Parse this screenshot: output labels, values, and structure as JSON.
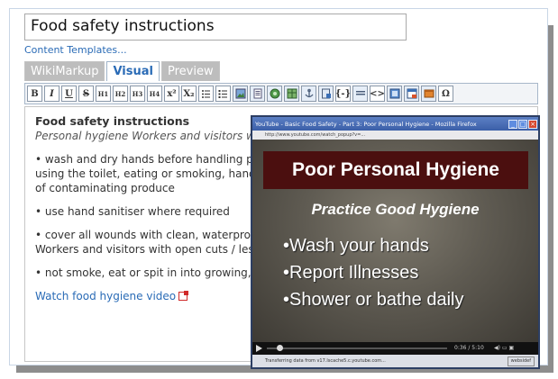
{
  "page": {
    "title_value": "Food safety instructions",
    "templates_link": "Content Templates..."
  },
  "tabs": [
    {
      "label": "WikiMarkup",
      "active": false
    },
    {
      "label": "Visual",
      "active": true
    },
    {
      "label": "Preview",
      "active": false
    }
  ],
  "toolbar": {
    "bold": "B",
    "italic": "I",
    "underline": "U",
    "strike": "S",
    "h1": "H1",
    "h2": "H2",
    "h3": "H3",
    "h4": "H4",
    "superscript": "x²",
    "subscript": "X₂",
    "icons": [
      "bullet-list-icon",
      "numbered-list-icon",
      "image-icon",
      "page-icon",
      "link-icon",
      "table-icon",
      "anchor-icon",
      "attachment-icon",
      "macro-icon",
      "horizontal-rule-icon",
      "code-icon",
      "widget-icon",
      "panel-icon",
      "library-icon",
      "special-char-icon"
    ],
    "macro_label": "{-}",
    "code_label": "<>",
    "special_char_label": "Ω"
  },
  "editor": {
    "heading": "Food safety instructions",
    "subheading": "Personal hygiene Workers and visitors will:",
    "bullet1_line1": "• wash and dry hands before handling produ",
    "bullet1_line2": "using the toilet, eating or smoking, handling",
    "bullet1_line3": "of contaminating produce",
    "bullet2": "• use hand sanitiser where required",
    "bullet3_line1": "• cover all wounds with clean, waterproof d",
    "bullet3_line2": "Workers and visitors with open cuts / lesion",
    "bullet4": "• not smoke, eat or spit in into growing, pa",
    "video_link": "Watch food hygiene video"
  },
  "video_window": {
    "window_title": "YouTube - Basic Food Safety - Part 3: Poor Personal Hygiene - Mozilla Firefox",
    "address": "http://www.youtube.com/watch_popup?v=...",
    "slide_title": "Poor Personal Hygiene",
    "slide_subtitle": "Practice Good Hygiene",
    "bullets": [
      "Wash your hands",
      "Report Illnesses",
      "Shower or bathe daily"
    ],
    "time": "0:36 / 5:10",
    "status_text": "Transferring data from v17.lscache5.c.youtube.com...",
    "status_right": "websidef",
    "progress_fraction": 0.07
  },
  "colors": {
    "link": "#2a6bb6",
    "banner": "#4b0f0f",
    "tab_active_text": "#2a6bb6"
  }
}
